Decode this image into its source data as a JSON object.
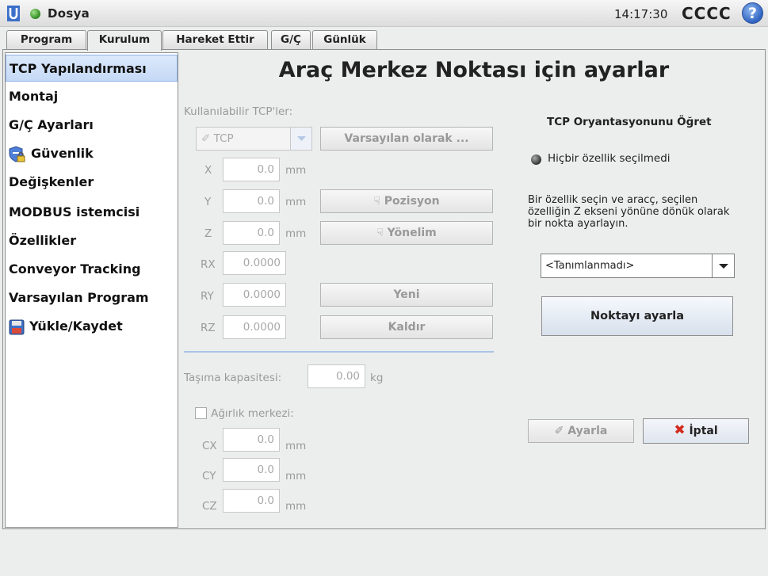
{
  "topbar": {
    "file_label": "Dosya",
    "clock": "14:17:30",
    "robot_name": "CCCC",
    "help": "?"
  },
  "tabs": [
    "Program",
    "Kurulum",
    "Hareket Ettir",
    "G/Ç",
    "Günlük"
  ],
  "sidebar": {
    "items": [
      "TCP Yapılandırması",
      "Montaj",
      "G/Ç Ayarları",
      "Güvenlik",
      "Değişkenler",
      "MODBUS istemcisi",
      "Özellikler",
      "Conveyor Tracking",
      "Varsayılan Program",
      "Yükle/Kaydet"
    ]
  },
  "main": {
    "title": "Araç Merkez Noktası için ayarlar",
    "available_tcps_label": "Kullanılabilir TCP'ler:",
    "tcp_selected": "TCP",
    "set_default_btn": "Varsayılan olarak ...",
    "position_btn": "Pozisyon",
    "orientation_btn": "Yönelim",
    "new_btn": "Yeni",
    "remove_btn": "Kaldır",
    "coords": [
      {
        "label": "X",
        "value": "0.0",
        "unit": "mm"
      },
      {
        "label": "Y",
        "value": "0.0",
        "unit": "mm"
      },
      {
        "label": "Z",
        "value": "0.0",
        "unit": "mm"
      },
      {
        "label": "RX",
        "value": "0.0000",
        "unit": ""
      },
      {
        "label": "RY",
        "value": "0.0000",
        "unit": ""
      },
      {
        "label": "RZ",
        "value": "0.0000",
        "unit": ""
      }
    ],
    "payload_label": "Taşıma kapasitesi:",
    "payload_value": "0.00",
    "payload_unit": "kg",
    "cog_label": "Ağırlık merkezi:",
    "cog": [
      {
        "label": "CX",
        "value": "0.0",
        "unit": "mm"
      },
      {
        "label": "CY",
        "value": "0.0",
        "unit": "mm"
      },
      {
        "label": "CZ",
        "value": "0.0",
        "unit": "mm"
      }
    ]
  },
  "teach": {
    "title": "TCP Oryantasyonunu Öğret",
    "no_feature": "Hiçbir özellik seçilmedi",
    "instructions": "Bir özellik seçin ve aracç, seçilen özelliğin Z ekseni yönüne dönük olarak bir nokta ayarlayın.",
    "feature_select": "<Tanımlanmadı>",
    "set_point_btn": "Noktayı ayarla",
    "apply_btn": "Ayarla",
    "cancel_btn": "İptal"
  },
  "colors": {
    "selected_bg": "#c5d9f6",
    "status_ok": "#2f8a1f",
    "cancel_red": "#d42b1e"
  }
}
